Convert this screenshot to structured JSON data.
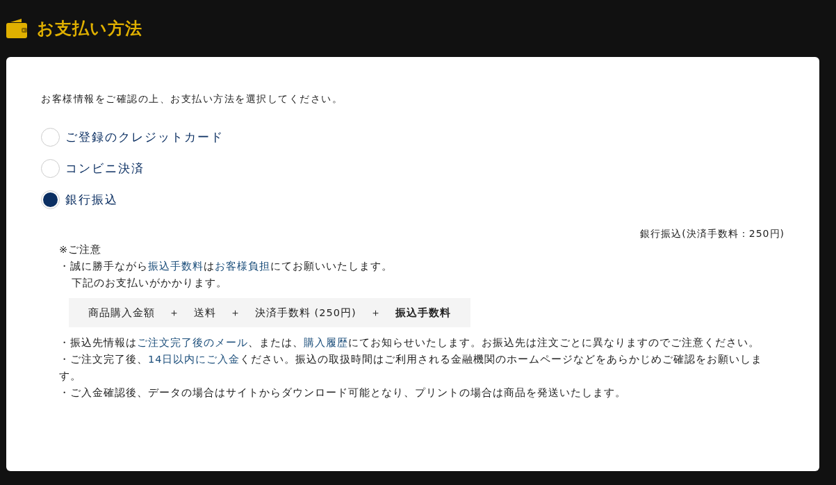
{
  "header": {
    "title": "お支払い方法"
  },
  "intro": "お客様情報をご確認の上、お支払い方法を選択してください。",
  "options": [
    {
      "label": "ご登録のクレジットカード",
      "selected": false
    },
    {
      "label": "コンビニ決済",
      "selected": false
    },
    {
      "label": "銀行振込",
      "selected": true
    }
  ],
  "fee_label": "銀行振込(決済手数料：250円)",
  "notice": {
    "heading": "※ご注意",
    "first": [
      {
        "text": "・誠に勝手ながら",
        "highlight": false
      },
      {
        "text": "振込手数料",
        "highlight": true
      },
      {
        "text": "は",
        "highlight": false
      },
      {
        "text": "お客様負担",
        "highlight": true
      },
      {
        "text": "にてお願いいたします。",
        "highlight": false
      }
    ],
    "first_cont": "下記のお支払いがかかります。",
    "formula": [
      {
        "text": "商品購入金額",
        "bold": false
      },
      {
        "text": "＋",
        "bold": false
      },
      {
        "text": "送料",
        "bold": false
      },
      {
        "text": "＋",
        "bold": false
      },
      {
        "text": "決済手数料 (250円)",
        "bold": false
      },
      {
        "text": "＋",
        "bold": false
      },
      {
        "text": "振込手数料",
        "bold": true
      }
    ],
    "items": [
      [
        {
          "text": "・振込先情報は",
          "highlight": false
        },
        {
          "text": "ご注文完了後のメール",
          "highlight": true
        },
        {
          "text": "、または、",
          "highlight": false
        },
        {
          "text": "購入履歴",
          "highlight": true
        },
        {
          "text": "にてお知らせいたします。お振込先は注文ごとに異なりますのでご注意ください。",
          "highlight": false
        }
      ],
      [
        {
          "text": "・ご注文完了後、",
          "highlight": false
        },
        {
          "text": "14日以内にご入金",
          "highlight": true
        },
        {
          "text": "ください。振込の取扱時間はご利用される金融機関のホームページなどをあらかじめご確認をお願いします。",
          "highlight": false
        }
      ],
      [
        {
          "text": "・ご入金確認後、データの場合はサイトからダウンロード可能となり、プリントの場合は商品を発送いたします。",
          "highlight": false
        }
      ]
    ]
  }
}
